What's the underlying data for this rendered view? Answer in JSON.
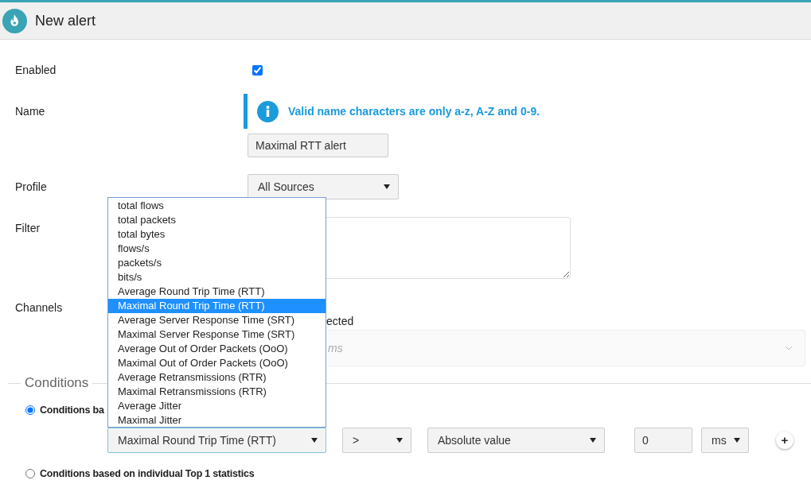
{
  "header": {
    "title": "New alert"
  },
  "form": {
    "enabled": {
      "label": "Enabled",
      "checked": true
    },
    "name": {
      "label": "Name",
      "hint": "Valid name characters are only a-z, A-Z and 0-9.",
      "value": "Maximal RTT alert"
    },
    "profile": {
      "label": "Profile",
      "value": "All Sources"
    },
    "filter": {
      "label": "Filter"
    },
    "channels": {
      "label": "Channels",
      "caption": "ected",
      "placeholder": "ms"
    }
  },
  "conditions": {
    "legend": "Conditions",
    "modes": [
      {
        "label": "Conditions ba",
        "selected": true
      },
      {
        "label": "Conditions based on individual Top 1 statistics",
        "selected": false
      }
    ],
    "row": {
      "statistic": "Maximal Round Trip Time (RTT)",
      "operator": ">",
      "comparison": "Absolute value",
      "value": "0",
      "unit": "ms",
      "add": "+"
    }
  },
  "statistic_dropdown": {
    "options": [
      {
        "label": "total flows",
        "selected": false
      },
      {
        "label": "total packets",
        "selected": false
      },
      {
        "label": "total bytes",
        "selected": false
      },
      {
        "label": "flows/s",
        "selected": false
      },
      {
        "label": "packets/s",
        "selected": false
      },
      {
        "label": "bits/s",
        "selected": false
      },
      {
        "label": "Average Round Trip Time (RTT)",
        "selected": false
      },
      {
        "label": "Maximal Round Trip Time (RTT)",
        "selected": true
      },
      {
        "label": "Average Server Response Time (SRT)",
        "selected": false
      },
      {
        "label": "Maximal Server Response Time (SRT)",
        "selected": false
      },
      {
        "label": "Average Out of Order Packets (OoO)",
        "selected": false
      },
      {
        "label": "Maximal Out of Order Packets (OoO)",
        "selected": false
      },
      {
        "label": "Average Retransmissions (RTR)",
        "selected": false
      },
      {
        "label": "Maximal Retransmissions (RTR)",
        "selected": false
      },
      {
        "label": "Average Jitter",
        "selected": false
      },
      {
        "label": "Maximal Jitter",
        "selected": false
      }
    ]
  }
}
